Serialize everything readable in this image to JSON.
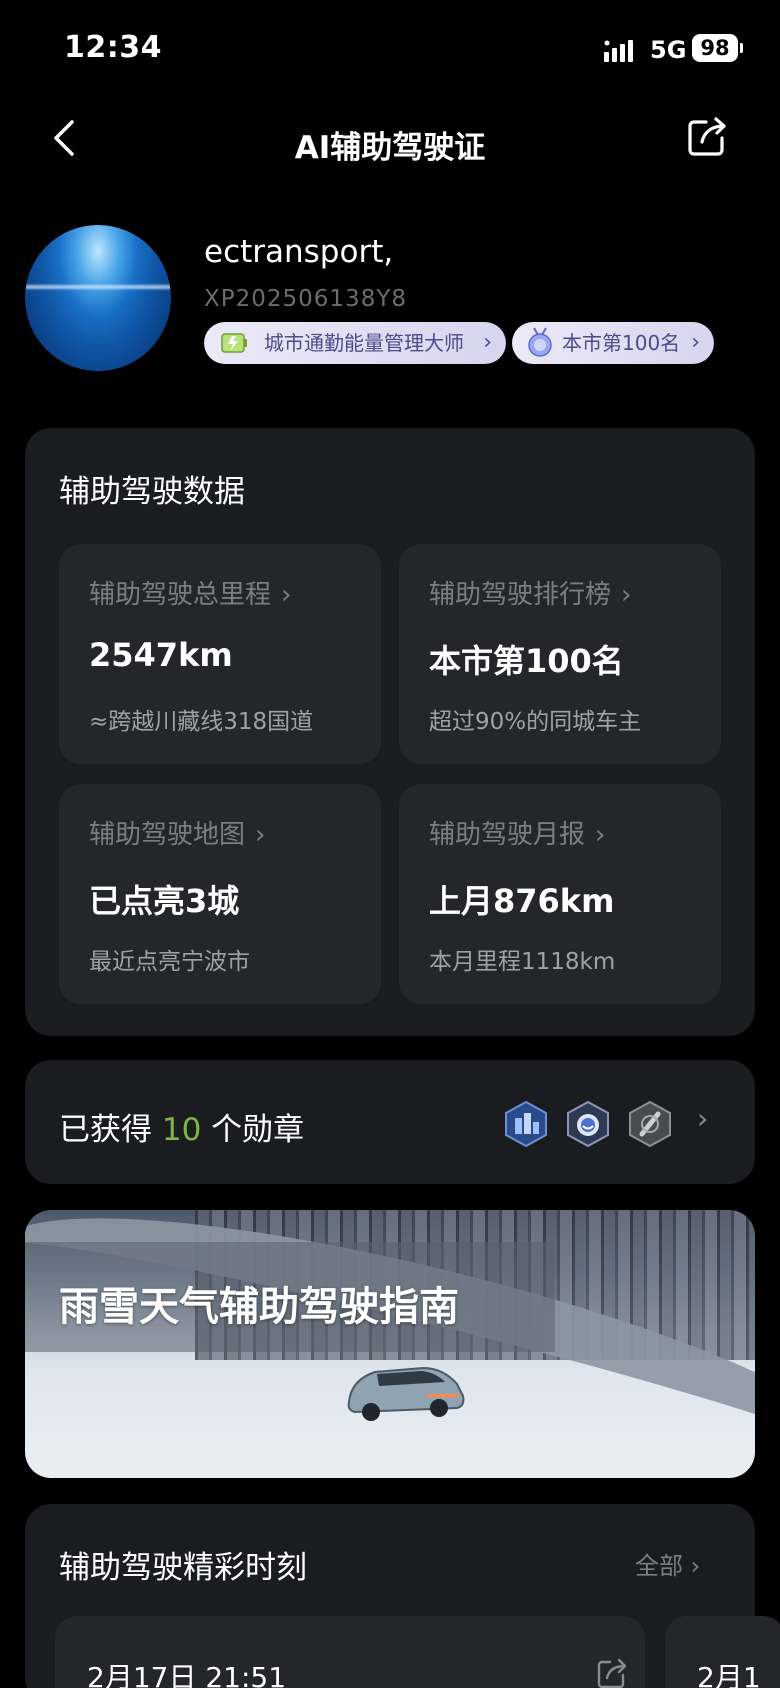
{
  "status_bar": {
    "time": "12:34",
    "network": "5G",
    "battery": "98"
  },
  "nav": {
    "title": "AI辅助驾驶证",
    "back_icon": "chevron-left-icon",
    "share_icon": "share-icon"
  },
  "profile": {
    "username": "ectransport,",
    "user_id": "XP202506138Y8",
    "tags": [
      {
        "label": "城市通勤能量管理大师",
        "chevron": "›"
      },
      {
        "label": "本市第100名",
        "chevron": "›"
      }
    ]
  },
  "data_section": {
    "title": "辅助驾驶数据",
    "chevron": "›",
    "stats": [
      {
        "label": "辅助驾驶总里程",
        "value": "2547km",
        "sub": "≈跨越川藏线318国道"
      },
      {
        "label": "辅助驾驶排行榜",
        "value": "本市第100名",
        "sub": "超过90%的同城车主"
      },
      {
        "label": "辅助驾驶地图",
        "value": "已点亮3城",
        "sub": "最近点亮宁波市"
      },
      {
        "label": "辅助驾驶月报",
        "value": "上月876km",
        "sub": "本月里程1118km"
      }
    ]
  },
  "medals": {
    "prefix": "已获得 ",
    "count": "10",
    "suffix": " 个勋章",
    "chevron": "›"
  },
  "banner": {
    "title": "雨雪天气辅助驾驶指南"
  },
  "moments": {
    "title": "辅助驾驶精彩时刻",
    "all_label": "全部 ›",
    "items": [
      {
        "time": "2月17日 21:51"
      },
      {
        "time": "2月1"
      }
    ]
  },
  "colors": {
    "background": "#000000",
    "card": "#1b1c1f",
    "tile": "#25262a",
    "accent_green": "#7fb545",
    "tag_text": "#4f4a8a"
  }
}
